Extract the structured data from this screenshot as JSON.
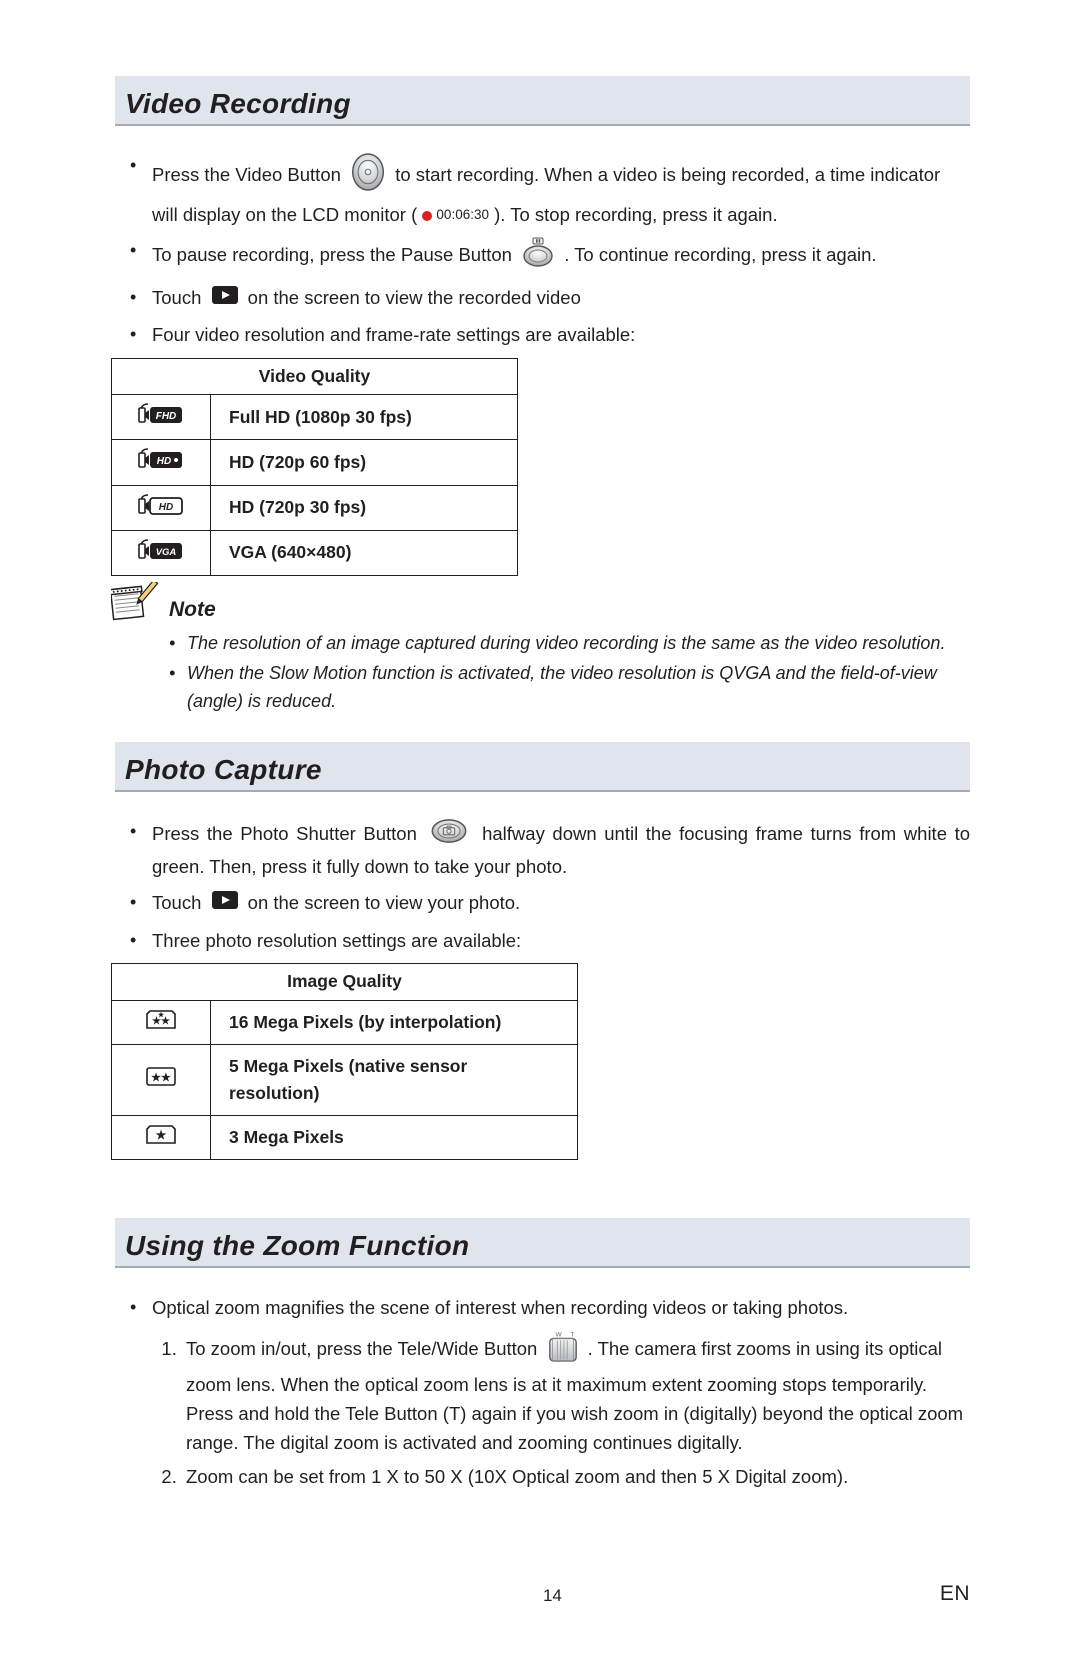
{
  "sections": {
    "video": {
      "title": "Video Recording"
    },
    "photo": {
      "title": "Photo Capture"
    },
    "zoom": {
      "title": "Using the Zoom Function"
    }
  },
  "video_bullets": {
    "l1a": "Press the Video Button",
    "l1b": "to start recording. When a video is being recorded, a time indicator will display on the LCD monitor (",
    "timecode": "00:06:30",
    "l1c": "). To stop recording, press it again.",
    "l2a": "To pause recording, press the  Pause Button",
    "l2b": ". To continue recording, press it again.",
    "l3a": "Touch",
    "l3b": "on the screen to view the recorded video",
    "l4": "Four video resolution and frame-rate settings are available:"
  },
  "video_table": {
    "header": "Video Quality",
    "rows": [
      "Full HD (1080p 30 fps)",
      "HD (720p 60 fps)",
      "HD (720p 30 fps)",
      "VGA (640×480)"
    ],
    "row_icon_labels": [
      "FHD",
      "HD•",
      "HD",
      "VGA"
    ]
  },
  "note": {
    "heading": "Note",
    "items": [
      "The resolution of an image captured during video recording is the same as the video resolution.",
      "When the Slow Motion function is activated, the video resolution is QVGA and the field-of-view (angle) is reduced."
    ]
  },
  "photo_bullets": {
    "l1a": "Press the Photo Shutter Button",
    "l1b": "halfway down until the focusing frame turns from white to green. Then, press it fully down to take your photo.",
    "l2a": "Touch",
    "l2b": "on the screen to view your photo.",
    "l3": "Three photo resolution settings are available:"
  },
  "image_table": {
    "header": "Image Quality",
    "rows": [
      "16 Mega Pixels (by interpolation)",
      "5 Mega Pixels (native sensor resolution)",
      "3 Mega Pixels"
    ]
  },
  "zoom_bullets": {
    "intro": "Optical zoom magnifies the scene of interest when recording videos or taking photos.",
    "n1a": "To zoom in/out, press the Tele/Wide Button",
    "n1b": ". The camera first zooms in using its optical zoom lens. When the optical zoom lens is at it maximum extent zooming stops temporarily. Press and hold the Tele Button (T) again if you wish zoom in (digitally) beyond the optical zoom range. The digital zoom is activated and zooming continues digitally.",
    "n2": "Zoom can be set from 1 X to 50 X (10X Optical zoom and then 5 X Digital zoom)."
  },
  "footer": {
    "page": "14",
    "lang": "EN"
  }
}
